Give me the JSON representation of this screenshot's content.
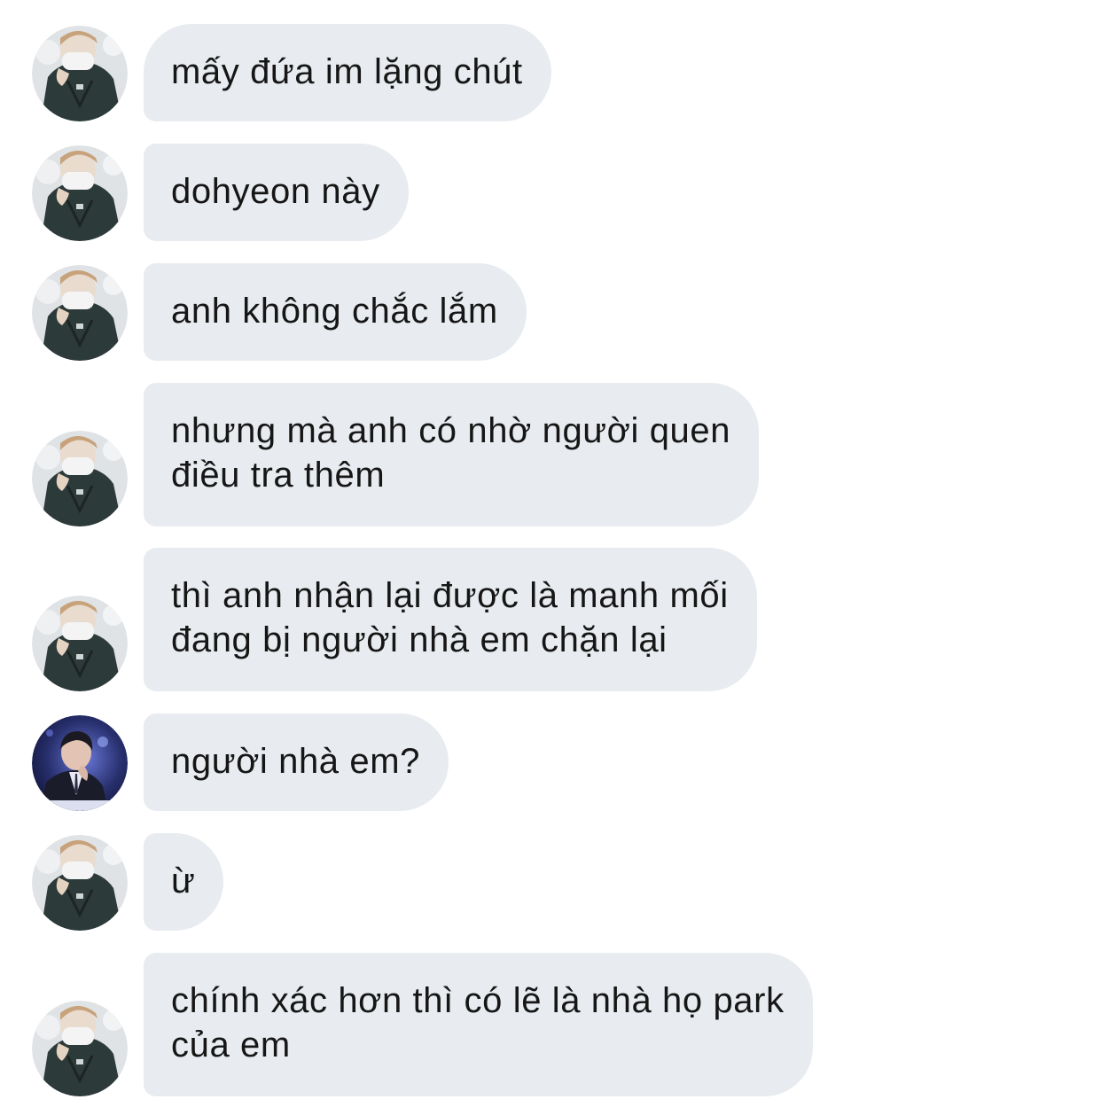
{
  "messages": [
    {
      "sender": "a",
      "text": "mấy đứa im lặng chút"
    },
    {
      "sender": "a",
      "text": "dohyeon này"
    },
    {
      "sender": "a",
      "text": "anh không chắc lắm"
    },
    {
      "sender": "a",
      "text": "nhưng mà anh có nhờ người quen\nđiều tra thêm"
    },
    {
      "sender": "a",
      "text": "thì anh nhận lại được là manh mối\nđang bị người nhà em chặn lại"
    },
    {
      "sender": "b",
      "text": "người nhà em?"
    },
    {
      "sender": "a",
      "text": "ừ"
    },
    {
      "sender": "a",
      "text": "chính xác hơn thì có lẽ là nhà họ park\ncủa em"
    }
  ],
  "colors": {
    "bubble_bg": "#e8ebef",
    "text": "#161616",
    "background": "#ffffff"
  },
  "avatars": {
    "a": "masked-person-in-dark-jacket-avatar",
    "b": "person-in-suit-on-stage-avatar"
  }
}
